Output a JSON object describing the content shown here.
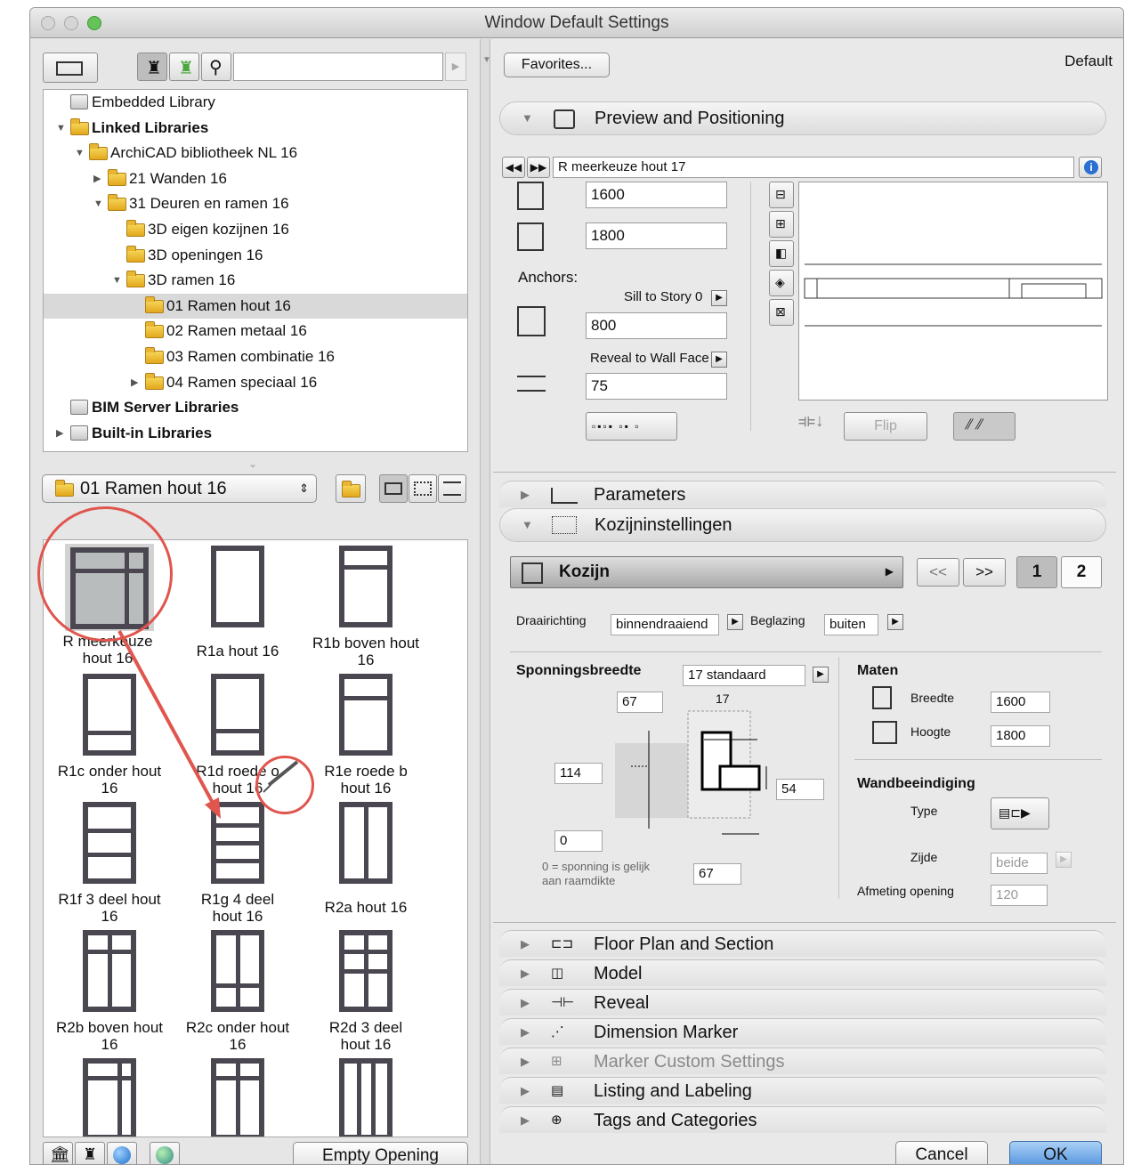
{
  "window": {
    "title": "Window Default Settings"
  },
  "left": {
    "search_placeholder": "",
    "tree": [
      {
        "label": "Embedded Library",
        "indent": 0,
        "kind": "lib",
        "arrow": ""
      },
      {
        "label": "Linked Libraries",
        "indent": 0,
        "kind": "folder",
        "arrow": "▼",
        "bold": true
      },
      {
        "label": "ArchiCAD bibliotheek NL 16",
        "indent": 1,
        "kind": "folder",
        "arrow": "▼"
      },
      {
        "label": "21 Wanden 16",
        "indent": 2,
        "kind": "folder",
        "arrow": "▶"
      },
      {
        "label": "31 Deuren en ramen 16",
        "indent": 2,
        "kind": "folder",
        "arrow": "▼"
      },
      {
        "label": "3D eigen kozijnen 16",
        "indent": 3,
        "kind": "folder",
        "arrow": ""
      },
      {
        "label": "3D openingen 16",
        "indent": 3,
        "kind": "folder",
        "arrow": ""
      },
      {
        "label": "3D ramen 16",
        "indent": 3,
        "kind": "folder",
        "arrow": "▼"
      },
      {
        "label": "01 Ramen hout 16",
        "indent": 4,
        "kind": "folder",
        "arrow": "",
        "selected": true
      },
      {
        "label": "02 Ramen metaal 16",
        "indent": 4,
        "kind": "folder",
        "arrow": ""
      },
      {
        "label": "03 Ramen combinatie 16",
        "indent": 4,
        "kind": "folder",
        "arrow": ""
      },
      {
        "label": "04 Ramen speciaal 16",
        "indent": 4,
        "kind": "folder",
        "arrow": "▶"
      },
      {
        "label": "BIM Server Libraries",
        "indent": 0,
        "kind": "lib",
        "arrow": "",
        "bold": true
      },
      {
        "label": "Built-in Libraries",
        "indent": 0,
        "kind": "lib",
        "arrow": "▶",
        "bold": true
      }
    ],
    "folder_select": "01 Ramen hout 16",
    "items": [
      {
        "l1": "R meerkeuze",
        "l2": "hout 16"
      },
      {
        "l1": "R1a hout 16",
        "l2": ""
      },
      {
        "l1": "R1b boven hout",
        "l2": "16"
      },
      {
        "l1": "R1c onder hout",
        "l2": "16"
      },
      {
        "l1": "R1d roede o",
        "l2": "hout 16"
      },
      {
        "l1": "R1e roede b",
        "l2": "hout 16"
      },
      {
        "l1": "R1f 3 deel hout",
        "l2": "16"
      },
      {
        "l1": "R1g 4 deel",
        "l2": "hout 16"
      },
      {
        "l1": "R2a hout 16",
        "l2": ""
      },
      {
        "l1": "R2b boven hout",
        "l2": "16"
      },
      {
        "l1": "R2c onder hout",
        "l2": "16"
      },
      {
        "l1": "R2d 3 deel",
        "l2": "hout 16"
      }
    ],
    "empty_opening": "Empty Opening"
  },
  "right": {
    "favorites": "Favorites...",
    "default_label": "Default",
    "preview_title": "Preview and Positioning",
    "object_name": "R meerkeuze hout 17",
    "width": "1600",
    "height": "1800",
    "anchors_label": "Anchors:",
    "sill_label": "Sill to Story 0",
    "sill_value": "800",
    "reveal_label": "Reveal to Wall Face",
    "reveal_value": "75",
    "flip": "Flip",
    "parameters": "Parameters",
    "kozijn_settings": "Kozijninstellingen",
    "kozijn": "Kozijn",
    "prev": "<<",
    "next": ">>",
    "page1": "1",
    "page2": "2",
    "draairichting_label": "Draairichting",
    "draairichting_value": "binnendraaiend",
    "beglazing_label": "Beglazing",
    "beglazing_value": "buiten",
    "sponning_label": "Sponningsbreedte",
    "sponning_value": "17 standaard",
    "d67a": "67",
    "d17": "17",
    "d114": "114",
    "d54": "54",
    "d0": "0",
    "d67b": "67",
    "note1": "0 = sponning is gelijk",
    "note2": "aan raamdikte",
    "maten_label": "Maten",
    "breedte_label": "Breedte",
    "breedte_value": "1600",
    "hoogte_label": "Hoogte",
    "hoogte_value": "1800",
    "wand_label": "Wandbeeindiging",
    "type_label": "Type",
    "zijde_label": "Zijde",
    "zijde_value": "beide",
    "afmeting_label": "Afmeting opening",
    "afmeting_value": "120",
    "sections": [
      "Floor Plan and Section",
      "Model",
      "Reveal",
      "Dimension Marker",
      "Marker Custom Settings",
      "Listing and Labeling",
      "Tags and Categories"
    ],
    "cancel": "Cancel",
    "ok": "OK"
  },
  "colors": {
    "accent": "#5b9bdc",
    "annotation": "#e0554e",
    "frame": "#4b4750"
  }
}
